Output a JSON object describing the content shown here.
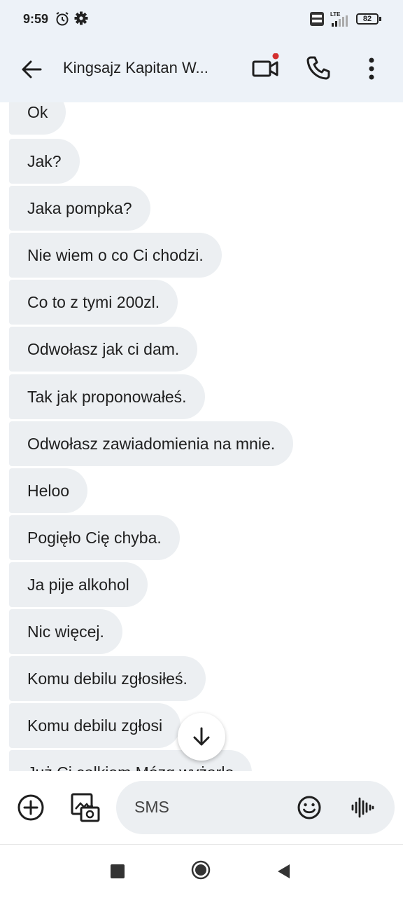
{
  "status_bar": {
    "time": "9:59",
    "battery": "82",
    "network": "LTE",
    "icons": [
      "alarm-icon",
      "gear-icon",
      "volte-icon",
      "signal-icon",
      "battery-icon"
    ]
  },
  "header": {
    "title": "Kingsajz Kapitan W...",
    "icons": [
      "back-arrow-icon",
      "video-call-icon",
      "phone-icon",
      "more-vert-icon"
    ]
  },
  "messages": [
    {
      "text": "Ok"
    },
    {
      "text": "Jak?"
    },
    {
      "text": "Jaka pompka?"
    },
    {
      "text": "Nie wiem o co Ci chodzi."
    },
    {
      "text": "Co to z tymi 200zl."
    },
    {
      "text": "Odwołasz jak ci dam."
    },
    {
      "text": "Tak jak proponowałeś."
    },
    {
      "text": "Odwołasz zawiadomienia na mnie."
    },
    {
      "text": "Heloo"
    },
    {
      "text": "Pogięło Cię chyba."
    },
    {
      "text": "Ja pije alkohol"
    },
    {
      "text": "Nic więcej."
    },
    {
      "text": "Komu debilu zgłosiłeś."
    },
    {
      "text": "Komu debilu zgłosi"
    },
    {
      "text": "Już Ci całkiem Mózg wyżarło"
    }
  ],
  "composer": {
    "placeholder": "SMS",
    "icons": [
      "add-circle-icon",
      "gallery-icon",
      "emoji-icon",
      "voice-wave-icon"
    ]
  },
  "colors": {
    "header_bg": "#edf2f8",
    "bubble_bg": "#eceff2",
    "notification_dot": "#d32f2f"
  }
}
